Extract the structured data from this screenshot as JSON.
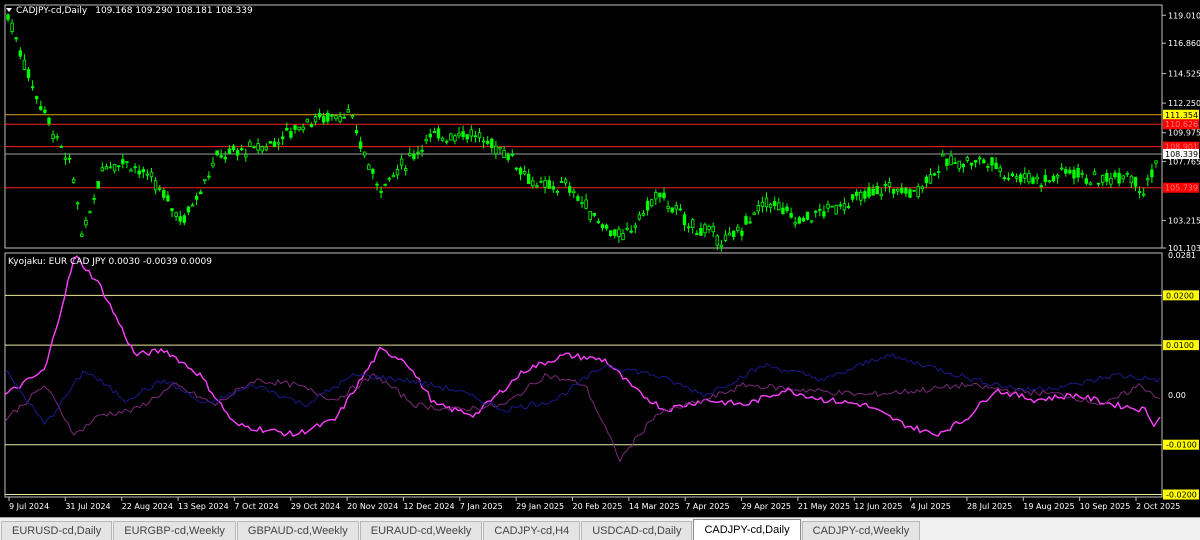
{
  "main_chart": {
    "title": "CADJPY-cd,Daily",
    "ohlc": "109.168 109.290 108.181 108.339",
    "price_axis": [
      "119.010",
      "116.860",
      "114.525",
      "112.250",
      "109.975",
      "107.765",
      "103.215",
      "101.103"
    ],
    "level_labels": [
      {
        "text": "111.354",
        "price": 111.354,
        "style": "yellow"
      },
      {
        "text": "110.626",
        "price": 110.626,
        "style": "red"
      },
      {
        "text": "108.901",
        "price": 108.901,
        "style": "red"
      },
      {
        "text": "108.339",
        "price": 108.339,
        "style": "white"
      },
      {
        "text": "105.739",
        "price": 105.739,
        "style": "red"
      }
    ],
    "lines": [
      {
        "price": 111.354,
        "color": "#e0a020"
      },
      {
        "price": 110.626,
        "color": "#ff2020"
      },
      {
        "price": 108.901,
        "color": "#ff2020"
      },
      {
        "price": 108.339,
        "color": "#a0a0a0"
      },
      {
        "price": 105.739,
        "color": "#ff2020"
      }
    ],
    "y_range": [
      101.103,
      119.8
    ],
    "candle_color": "#00ff00"
  },
  "indicator": {
    "title": "Kyojaku: EUR CAD JPY 0.0030 -0.0039 0.0009",
    "axis": [
      "0.0281",
      "0.0200",
      "0.0100",
      "0.00",
      "-0.0100",
      "-0.0200"
    ],
    "boxed_labels": [
      "0.0200",
      "0.0100",
      "-0.0100",
      "-0.0200"
    ],
    "levels": [
      0.02,
      0.01,
      -0.01,
      -0.02
    ],
    "y_range": [
      -0.0205,
      0.0285
    ],
    "series_colors": {
      "EUR": "#1a1a8c",
      "CAD": "#7a2a7a",
      "JPY": "#ff40ff"
    }
  },
  "date_axis": [
    "9 Jul 2024",
    "31 Jul 2024",
    "22 Aug 2024",
    "13 Sep 2024",
    "7 Oct 2024",
    "29 Oct 2024",
    "20 Nov 2024",
    "12 Dec 2024",
    "7 Jan 2025",
    "29 Jan 2025",
    "20 Feb 2025",
    "14 Mar 2025",
    "7 Apr 2025",
    "29 Apr 2025",
    "21 May 2025",
    "12 Jun 2025",
    "4 Jul 2025",
    "28 Jul 2025",
    "19 Aug 2025",
    "10 Sep 2025",
    "2 Oct 2025"
  ],
  "tabs": [
    {
      "label": "EURUSD-cd,Daily",
      "active": false
    },
    {
      "label": "EURGBP-cd,Weekly",
      "active": false
    },
    {
      "label": "GBPAUD-cd,Weekly",
      "active": false
    },
    {
      "label": "EURAUD-cd,Weekly",
      "active": false
    },
    {
      "label": "CADJPY-cd,H4",
      "active": false
    },
    {
      "label": "USDCAD-cd,Daily",
      "active": false
    },
    {
      "label": "CADJPY-cd,Daily",
      "active": true
    },
    {
      "label": "CADJPY-cd,Weekly",
      "active": false
    }
  ]
}
